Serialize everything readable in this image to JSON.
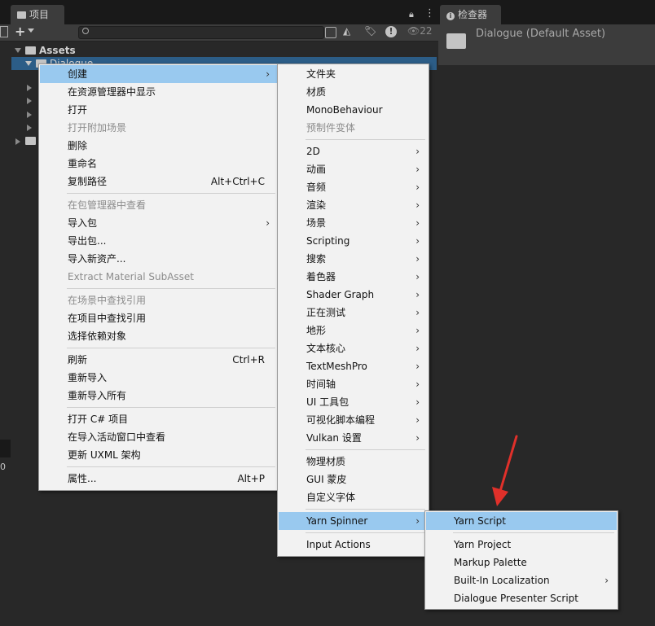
{
  "project_tab": {
    "label": "项目"
  },
  "inspector_tab": {
    "label": "检查器"
  },
  "toolbar": {
    "add_label": "+",
    "badge_count": "22"
  },
  "tree": {
    "root": "Assets",
    "selected": "Dialogue"
  },
  "inspector": {
    "title": "Dialogue (Default Asset)"
  },
  "left_edge_text": "0",
  "context_menu": [
    {
      "label": "创建",
      "arrow": true,
      "highlight": true
    },
    {
      "label": "在资源管理器中显示"
    },
    {
      "label": "打开"
    },
    {
      "label": "打开附加场景",
      "disabled": true
    },
    {
      "label": "删除"
    },
    {
      "label": "重命名"
    },
    {
      "label": "复制路径",
      "shortcut": "Alt+Ctrl+C"
    },
    {
      "separator": true
    },
    {
      "label": "在包管理器中查看",
      "disabled": true
    },
    {
      "label": "导入包",
      "arrow": true
    },
    {
      "label": "导出包..."
    },
    {
      "label": "导入新资产..."
    },
    {
      "label": "Extract Material SubAsset",
      "disabled": true
    },
    {
      "separator": true
    },
    {
      "label": "在场景中查找引用",
      "disabled": true
    },
    {
      "label": "在项目中查找引用"
    },
    {
      "label": "选择依赖对象"
    },
    {
      "separator": true
    },
    {
      "label": "刷新",
      "shortcut": "Ctrl+R"
    },
    {
      "label": "重新导入"
    },
    {
      "label": "重新导入所有"
    },
    {
      "separator": true
    },
    {
      "label": "打开 C# 项目"
    },
    {
      "label": "在导入活动窗口中查看"
    },
    {
      "label": "更新 UXML 架构"
    },
    {
      "separator": true
    },
    {
      "label": "属性...",
      "shortcut": "Alt+P"
    }
  ],
  "create_menu": [
    {
      "label": "文件夹"
    },
    {
      "label": "材质"
    },
    {
      "label": "MonoBehaviour"
    },
    {
      "label": "预制件变体",
      "disabled": true
    },
    {
      "separator": true
    },
    {
      "label": "2D",
      "arrow": true
    },
    {
      "label": "动画",
      "arrow": true
    },
    {
      "label": "音频",
      "arrow": true
    },
    {
      "label": "渲染",
      "arrow": true
    },
    {
      "label": "场景",
      "arrow": true
    },
    {
      "label": "Scripting",
      "arrow": true
    },
    {
      "label": "搜索",
      "arrow": true
    },
    {
      "label": "着色器",
      "arrow": true
    },
    {
      "label": "Shader Graph",
      "arrow": true
    },
    {
      "label": "正在测试",
      "arrow": true
    },
    {
      "label": "地形",
      "arrow": true
    },
    {
      "label": "文本核心",
      "arrow": true
    },
    {
      "label": "TextMeshPro",
      "arrow": true
    },
    {
      "label": "时间轴",
      "arrow": true
    },
    {
      "label": "UI 工具包",
      "arrow": true
    },
    {
      "label": "可视化脚本编程",
      "arrow": true
    },
    {
      "label": "Vulkan 设置",
      "arrow": true
    },
    {
      "separator": true
    },
    {
      "label": "物理材质"
    },
    {
      "label": "GUI 蒙皮"
    },
    {
      "label": "自定义字体"
    },
    {
      "separator": true
    },
    {
      "label": "Yarn Spinner",
      "arrow": true,
      "highlight": true
    },
    {
      "separator": true
    },
    {
      "label": "Input Actions"
    }
  ],
  "yarn_menu": [
    {
      "label": "Yarn Script",
      "highlight": true
    },
    {
      "separator": true
    },
    {
      "label": "Yarn Project"
    },
    {
      "label": "Markup Palette"
    },
    {
      "label": "Built-In Localization",
      "arrow": true
    },
    {
      "label": "Dialogue Presenter Script"
    }
  ],
  "colors": {
    "highlight": "#99c9ef",
    "selection": "#2c5d87",
    "annotation_arrow": "#e0302a"
  }
}
